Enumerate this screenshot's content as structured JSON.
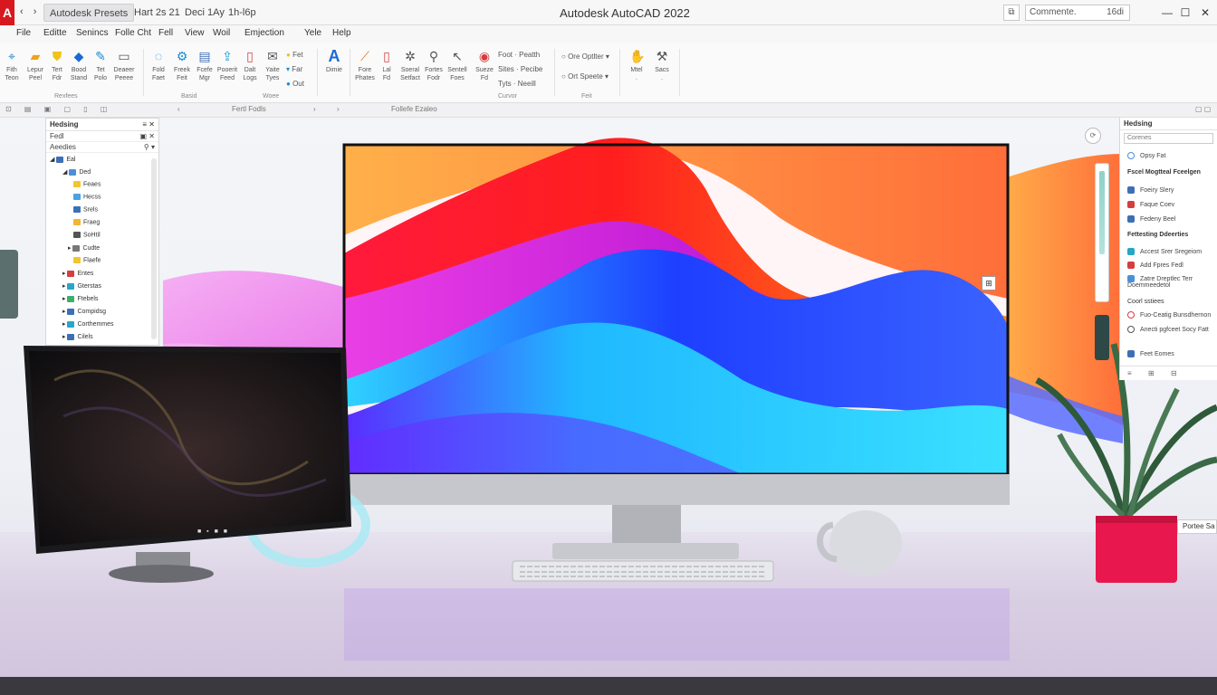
{
  "titlebar": {
    "logo": "A",
    "nav": "‹ ›",
    "tabs": [
      "Autodesk Presets",
      "Hart 2s 21",
      "Deci 1Ay",
      "1h-l6p"
    ],
    "title": "Autodesk AutoCAD 2022",
    "search_label": "Commente.",
    "user_label": "16di",
    "controls": [
      "—",
      "☐",
      "✕"
    ]
  },
  "menu": [
    "File",
    "Editte",
    "Senincs",
    "Folle Cht",
    "Fell",
    "View",
    "Woil",
    "Emjection",
    "Yele",
    "Help"
  ],
  "ribbon": {
    "buttons": [
      {
        "label": "Fith\nTeon"
      },
      {
        "label": "Lepur\nPeel"
      },
      {
        "label": "Tert\nFdr"
      },
      {
        "label": "Bood\nStand"
      },
      {
        "label": "Tet\nPolo"
      },
      {
        "label": "Deaeer\nPeeee"
      },
      {
        "label": "Fold\nFaet"
      },
      {
        "label": "Freek\nFeit"
      },
      {
        "label": "Fcefe\nMgr"
      },
      {
        "label": "Pooerit\nFeed"
      },
      {
        "label": "Dalt\nLogs"
      },
      {
        "label": "Yaite\nTyes"
      },
      {
        "label": "Dimie"
      },
      {
        "label": "Fore\nPhates"
      },
      {
        "label": "Lal\nFd"
      },
      {
        "label": "Soeral\nSetfact"
      },
      {
        "label": "Fortes\nFodr"
      },
      {
        "label": "Sentell\nFoes"
      },
      {
        "label": "Sueze\nFd"
      },
      {
        "label": "Mtel\n."
      },
      {
        "label": "Sacs\n."
      }
    ],
    "small_items": [
      "Fet",
      "Far",
      "Out",
      "Foot · Peatth",
      "Sites · Pecibe",
      "Tyts · Neeill",
      "Ore Optlter",
      "Ort Speete"
    ],
    "groups": [
      "Rexfees",
      "Basid",
      "Woee",
      "Curvor",
      "Feit"
    ]
  },
  "subbar": [
    "Fertl Fodls",
    "Follefe Ezaleo"
  ],
  "left_panel": {
    "title": "Hedsing",
    "field": "Fedl",
    "filter": "Aeedies",
    "tree": [
      {
        "label": "Eal",
        "color": "#3d6fb6"
      },
      {
        "label": "Ded",
        "color": "#4a90d9"
      },
      {
        "label": "Feaes",
        "color": "#f2c531"
      },
      {
        "label": "Hecss",
        "color": "#4aa3e0"
      },
      {
        "label": "Srels",
        "color": "#3d6fb6"
      },
      {
        "label": "Fraeg",
        "color": "#f2b531"
      },
      {
        "label": "SoHtil",
        "color": "#555"
      },
      {
        "label": "Cudte",
        "color": "#777"
      },
      {
        "label": "Flaefe",
        "color": "#f2c531"
      },
      {
        "label": "Entes",
        "color": "#d63d3d"
      },
      {
        "label": "Gterstas",
        "color": "#26a6c9"
      },
      {
        "label": "Ftebels",
        "color": "#3caf6a"
      },
      {
        "label": "Compidsg",
        "color": "#3d6fb6"
      },
      {
        "label": "Corthemmes",
        "color": "#26a6c9"
      },
      {
        "label": "Cilels",
        "color": "#3d6fb6"
      }
    ]
  },
  "right_panel": {
    "title": "Hedsing",
    "search": "Corenes",
    "items": [
      {
        "type": "item",
        "label": "Opsy Fat",
        "color": "#4a90d9"
      },
      {
        "type": "section",
        "label": "Fscel Mogtteal Fceelgen"
      },
      {
        "type": "item",
        "label": "Foeiry Slery",
        "color": "#3d6fb6"
      },
      {
        "type": "item",
        "label": "Faque Coev",
        "color": "#d63d3d"
      },
      {
        "type": "item",
        "label": "Fedeny Beel",
        "color": "#3d6fb6"
      },
      {
        "type": "section",
        "label": "Fettesting Ddeerties"
      },
      {
        "type": "item",
        "label": "Accest Srer Sregeiom",
        "color": "#26a6c9"
      },
      {
        "type": "item",
        "label": "Add Fpres Fedl",
        "color": "#d63d3d"
      },
      {
        "type": "item",
        "label": "Zatre Dreptlec Terr Doemmeedetol",
        "color": "#4a90d9"
      },
      {
        "type": "section",
        "label": "Coorl sstiees"
      },
      {
        "type": "item",
        "label": "Fuo-Ceatig Bunsdhernon",
        "color": "#d63d3d"
      },
      {
        "type": "item",
        "label": "Anecti pgfceet Socy Fatt",
        "color": "#555"
      },
      {
        "type": "item",
        "label": "Feet Eomes",
        "color": "#3d6fb6"
      }
    ],
    "toolbar": "≡ ⊞ ⊟",
    "footer_tag": "Portee Sa"
  },
  "monitor_caption": "■ ▪ ■ ■",
  "colors": {
    "brand": "#d8181f",
    "wave_magenta": "#e63fe0",
    "wave_red": "#ff1e1e",
    "wave_orange": "#ff9a1a",
    "wave_blue": "#1e3fff",
    "wave_cyan": "#2fd2ff",
    "plant_pot": "#e8184e"
  }
}
